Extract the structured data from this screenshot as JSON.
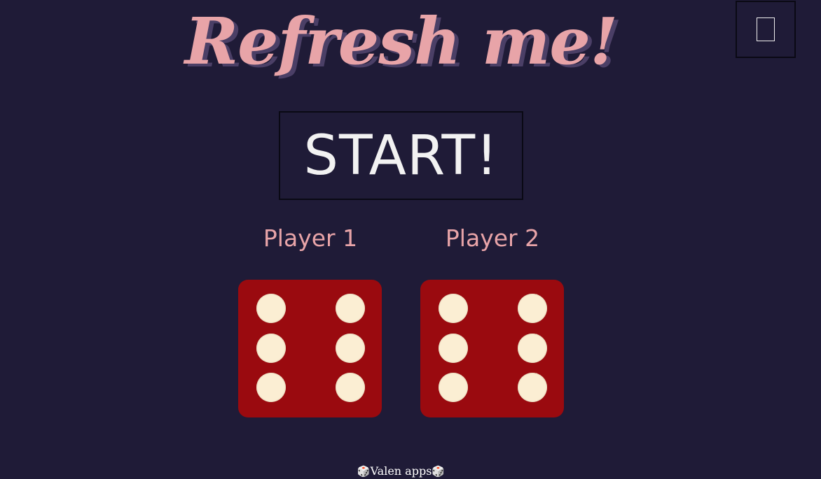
{
  "title": "Refresh me!",
  "corner_button": {
    "icon": "unknown-glyph-icon"
  },
  "start_button": {
    "label": "START!"
  },
  "players": [
    {
      "label": "Player 1",
      "die_value": 6
    },
    {
      "label": "Player 2",
      "die_value": 6
    }
  ],
  "footer": {
    "text": "Valen apps",
    "icon": "dice-icon",
    "icon_char": "🎲"
  },
  "colors": {
    "background": "#1f1b37",
    "title": "#e8a4a8",
    "die_face": "#9a0a0f",
    "pip": "#fbeed3"
  }
}
